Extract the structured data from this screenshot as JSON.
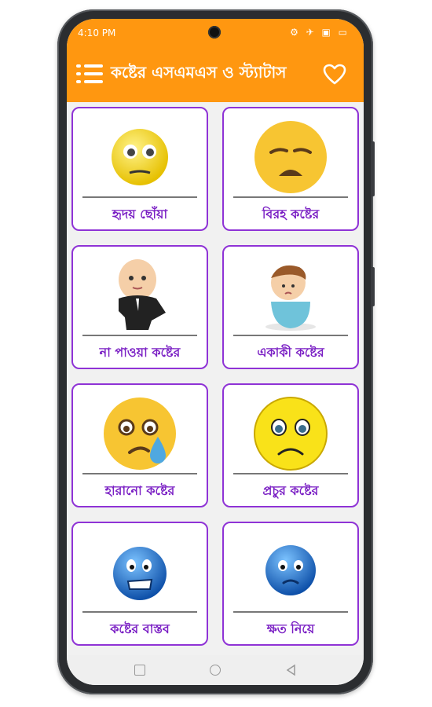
{
  "status_bar": {
    "time": "4:10 PM",
    "icons": "⚙ ✈ ▣ ▭"
  },
  "app_bar": {
    "title": "কষ্টের এসএমএস ও স্ট্যাটাস",
    "menu_icon": "menu-icon",
    "favorite_icon": "heart-icon"
  },
  "colors": {
    "accent": "#ff9710",
    "card_border": "#8f33d6",
    "label": "#7a1fc4"
  },
  "cards": [
    {
      "label": "হৃদয় ছোঁয়া",
      "icon": "worried-face-icon"
    },
    {
      "label": "বিরহ কষ্টের",
      "icon": "disappointed-face-icon"
    },
    {
      "label": "না পাওয়া কষ্টের",
      "icon": "boss-baby-icon"
    },
    {
      "label": "একাকী কষ্টের",
      "icon": "sad-child-icon"
    },
    {
      "label": "হারানো কষ্টের",
      "icon": "crying-face-icon"
    },
    {
      "label": "প্রচুর কষ্টের",
      "icon": "teary-face-icon"
    },
    {
      "label": "কষ্টের বাস্তব",
      "icon": "grimacing-blue-face-icon"
    },
    {
      "label": "ক্ষত নিয়ে",
      "icon": "sad-blue-face-icon"
    }
  ]
}
